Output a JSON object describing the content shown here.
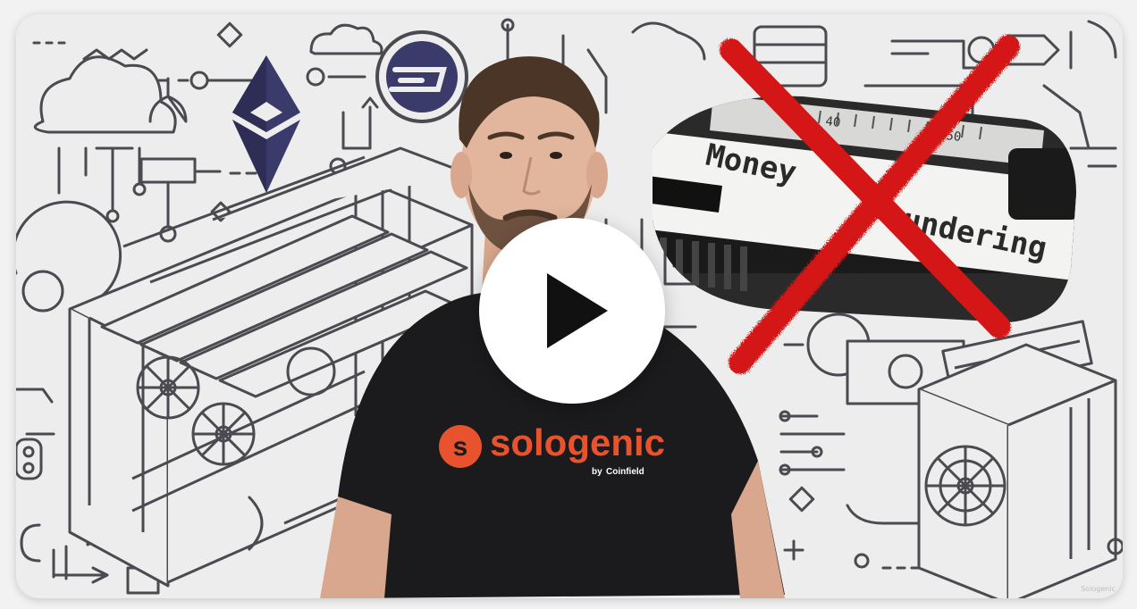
{
  "video": {
    "play_label": "Play video",
    "shirt_logo_glyph": "s",
    "shirt_brand": "sologenic",
    "shirt_byline": "by",
    "shirt_partner": "Coinfield",
    "paper_word_1": "Money",
    "paper_word_2": "undering",
    "ruler_mark_1": "40",
    "ruler_mark_2": "50",
    "watermark": "Sologenic"
  },
  "colors": {
    "brand_orange": "#e8532e",
    "cross_red": "#d41515",
    "doodle_stroke": "#4a4a50",
    "shirt": "#1b1b1d"
  },
  "icons": [
    "play-icon",
    "ethereum-icon",
    "dash-coin-icon",
    "cloud-icon",
    "lightbulb-icon",
    "padlock-icon",
    "gpu-mining-rig-icon",
    "asic-miner-icon",
    "red-cross-mark-icon"
  ]
}
